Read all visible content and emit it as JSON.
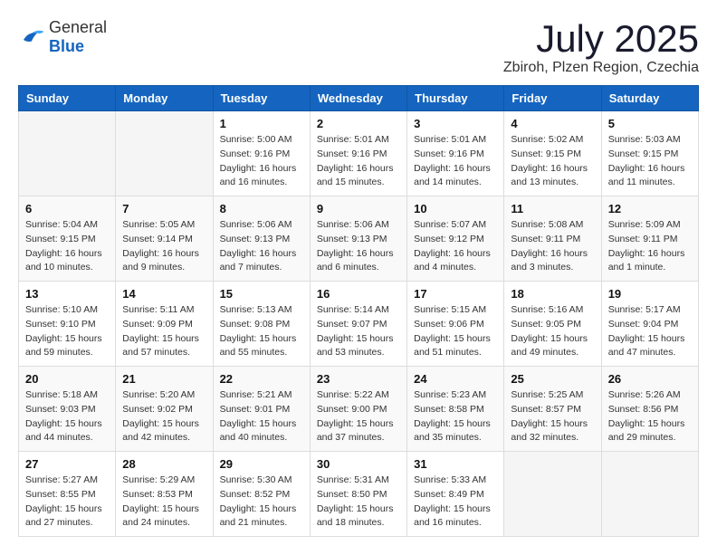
{
  "logo": {
    "general": "General",
    "blue": "Blue"
  },
  "title": "July 2025",
  "location": "Zbiroh, Plzen Region, Czechia",
  "weekdays": [
    "Sunday",
    "Monday",
    "Tuesday",
    "Wednesday",
    "Thursday",
    "Friday",
    "Saturday"
  ],
  "weeks": [
    [
      {
        "day": "",
        "info": ""
      },
      {
        "day": "",
        "info": ""
      },
      {
        "day": "1",
        "info": "Sunrise: 5:00 AM\nSunset: 9:16 PM\nDaylight: 16 hours and 16 minutes."
      },
      {
        "day": "2",
        "info": "Sunrise: 5:01 AM\nSunset: 9:16 PM\nDaylight: 16 hours and 15 minutes."
      },
      {
        "day": "3",
        "info": "Sunrise: 5:01 AM\nSunset: 9:16 PM\nDaylight: 16 hours and 14 minutes."
      },
      {
        "day": "4",
        "info": "Sunrise: 5:02 AM\nSunset: 9:15 PM\nDaylight: 16 hours and 13 minutes."
      },
      {
        "day": "5",
        "info": "Sunrise: 5:03 AM\nSunset: 9:15 PM\nDaylight: 16 hours and 11 minutes."
      }
    ],
    [
      {
        "day": "6",
        "info": "Sunrise: 5:04 AM\nSunset: 9:15 PM\nDaylight: 16 hours and 10 minutes."
      },
      {
        "day": "7",
        "info": "Sunrise: 5:05 AM\nSunset: 9:14 PM\nDaylight: 16 hours and 9 minutes."
      },
      {
        "day": "8",
        "info": "Sunrise: 5:06 AM\nSunset: 9:13 PM\nDaylight: 16 hours and 7 minutes."
      },
      {
        "day": "9",
        "info": "Sunrise: 5:06 AM\nSunset: 9:13 PM\nDaylight: 16 hours and 6 minutes."
      },
      {
        "day": "10",
        "info": "Sunrise: 5:07 AM\nSunset: 9:12 PM\nDaylight: 16 hours and 4 minutes."
      },
      {
        "day": "11",
        "info": "Sunrise: 5:08 AM\nSunset: 9:11 PM\nDaylight: 16 hours and 3 minutes."
      },
      {
        "day": "12",
        "info": "Sunrise: 5:09 AM\nSunset: 9:11 PM\nDaylight: 16 hours and 1 minute."
      }
    ],
    [
      {
        "day": "13",
        "info": "Sunrise: 5:10 AM\nSunset: 9:10 PM\nDaylight: 15 hours and 59 minutes."
      },
      {
        "day": "14",
        "info": "Sunrise: 5:11 AM\nSunset: 9:09 PM\nDaylight: 15 hours and 57 minutes."
      },
      {
        "day": "15",
        "info": "Sunrise: 5:13 AM\nSunset: 9:08 PM\nDaylight: 15 hours and 55 minutes."
      },
      {
        "day": "16",
        "info": "Sunrise: 5:14 AM\nSunset: 9:07 PM\nDaylight: 15 hours and 53 minutes."
      },
      {
        "day": "17",
        "info": "Sunrise: 5:15 AM\nSunset: 9:06 PM\nDaylight: 15 hours and 51 minutes."
      },
      {
        "day": "18",
        "info": "Sunrise: 5:16 AM\nSunset: 9:05 PM\nDaylight: 15 hours and 49 minutes."
      },
      {
        "day": "19",
        "info": "Sunrise: 5:17 AM\nSunset: 9:04 PM\nDaylight: 15 hours and 47 minutes."
      }
    ],
    [
      {
        "day": "20",
        "info": "Sunrise: 5:18 AM\nSunset: 9:03 PM\nDaylight: 15 hours and 44 minutes."
      },
      {
        "day": "21",
        "info": "Sunrise: 5:20 AM\nSunset: 9:02 PM\nDaylight: 15 hours and 42 minutes."
      },
      {
        "day": "22",
        "info": "Sunrise: 5:21 AM\nSunset: 9:01 PM\nDaylight: 15 hours and 40 minutes."
      },
      {
        "day": "23",
        "info": "Sunrise: 5:22 AM\nSunset: 9:00 PM\nDaylight: 15 hours and 37 minutes."
      },
      {
        "day": "24",
        "info": "Sunrise: 5:23 AM\nSunset: 8:58 PM\nDaylight: 15 hours and 35 minutes."
      },
      {
        "day": "25",
        "info": "Sunrise: 5:25 AM\nSunset: 8:57 PM\nDaylight: 15 hours and 32 minutes."
      },
      {
        "day": "26",
        "info": "Sunrise: 5:26 AM\nSunset: 8:56 PM\nDaylight: 15 hours and 29 minutes."
      }
    ],
    [
      {
        "day": "27",
        "info": "Sunrise: 5:27 AM\nSunset: 8:55 PM\nDaylight: 15 hours and 27 minutes."
      },
      {
        "day": "28",
        "info": "Sunrise: 5:29 AM\nSunset: 8:53 PM\nDaylight: 15 hours and 24 minutes."
      },
      {
        "day": "29",
        "info": "Sunrise: 5:30 AM\nSunset: 8:52 PM\nDaylight: 15 hours and 21 minutes."
      },
      {
        "day": "30",
        "info": "Sunrise: 5:31 AM\nSunset: 8:50 PM\nDaylight: 15 hours and 18 minutes."
      },
      {
        "day": "31",
        "info": "Sunrise: 5:33 AM\nSunset: 8:49 PM\nDaylight: 15 hours and 16 minutes."
      },
      {
        "day": "",
        "info": ""
      },
      {
        "day": "",
        "info": ""
      }
    ]
  ]
}
